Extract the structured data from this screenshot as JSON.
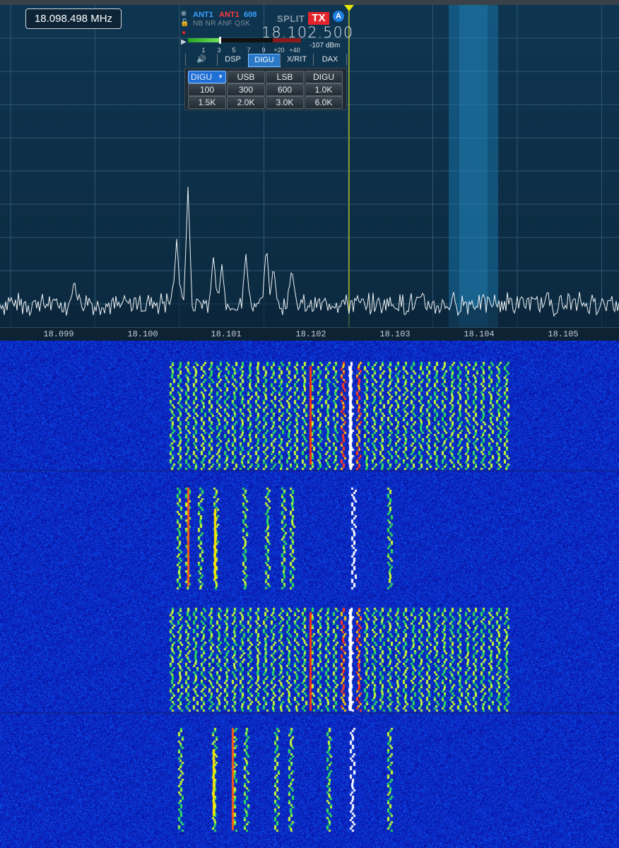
{
  "panadapter": {
    "tuned_frequency": "18.098.498 MHz",
    "frequency_axis": [
      "18.099",
      "18.100",
      "18.101",
      "18.102",
      "18.103",
      "18.104",
      "18.105"
    ]
  },
  "slice": {
    "rx_antenna": "ANT1",
    "tx_antenna": "ANT1",
    "filter_width": "608",
    "options": "NB NR ANF QSK",
    "split_label": "SPLIT",
    "tx_label": "TX",
    "slice_letter": "A",
    "frequency": "18.102.500",
    "signal_level": "-107 dBm",
    "s_meter_scale": [
      "1",
      "3",
      "5",
      "7",
      "9",
      "+20",
      "+40"
    ],
    "tabs": [
      "DSP",
      "DIGU",
      "X/RIT",
      "DAX"
    ],
    "active_tab": "DIGU",
    "mode_dropdown": "DIGU",
    "mode_buttons": [
      "USB",
      "LSB",
      "DIGU"
    ],
    "filter_buttons": [
      "100",
      "300",
      "600",
      "1.0K",
      "1.5K",
      "2.0K",
      "3.0K",
      "6.0K"
    ]
  },
  "colors": {
    "panadapter_bg": "#0d2f47",
    "waterfall_bg": "#0b1fa8",
    "tx_marker": "#e6e600",
    "tx_badge": "#e3242b",
    "slice_badge": "#1e7fe0"
  }
}
